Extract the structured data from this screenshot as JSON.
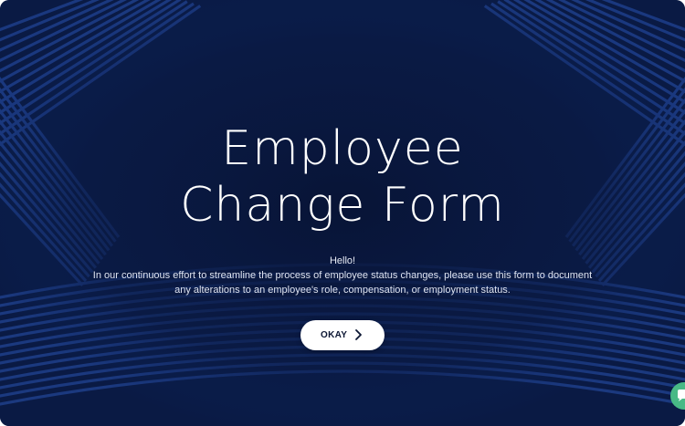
{
  "title_lines": [
    "Employee",
    "Change Form"
  ],
  "greeting": "Hello!",
  "description": "In our continuous effort to streamline the process of employee status changes, please use this form to document any alterations to an employee's role, compensation, or employment status.",
  "okay_button": {
    "label": "OKAY",
    "icon": "chevron-right-icon"
  },
  "help_button": {
    "icon": "chat-bubble-icon"
  },
  "colors": {
    "background": "#0a1a44",
    "stripe": "#1e3f8a",
    "button_bg": "#ffffff",
    "help_fab": "#48b986"
  }
}
